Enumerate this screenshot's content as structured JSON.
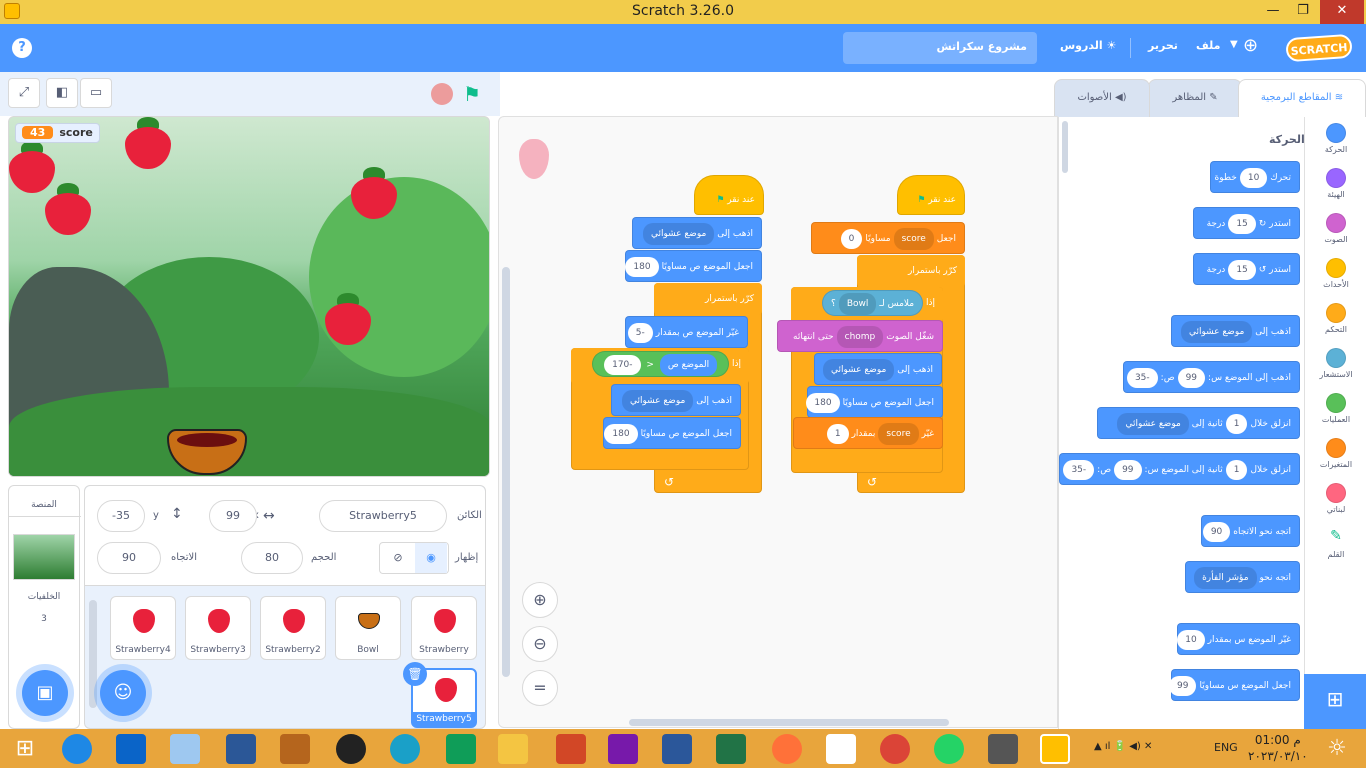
{
  "window": {
    "title": "Scratch 3.26.0",
    "minimize": "—",
    "restore": "❐",
    "close": "✕"
  },
  "menu": {
    "logo": "SCRATCH",
    "file": "ملف",
    "edit": "تحرير",
    "tutorials": "الدروس",
    "project_name": "مشروع سكراتش",
    "help": "?"
  },
  "tabs": {
    "code": "المقاطع البرمجية",
    "costumes": "المظاهر",
    "sounds": "الأصوات"
  },
  "stage": {
    "monitor_label": "score",
    "monitor_value": "43"
  },
  "sprite_info": {
    "sprite_label": "الكائن",
    "sprite_name": "Strawberry5",
    "x_label": "x",
    "x_value": "99",
    "y_label": "y",
    "y_value": "-35",
    "show_label": "إظهار",
    "size_label": "الحجم",
    "size_value": "80",
    "direction_label": "الاتجاه",
    "direction_value": "90"
  },
  "sprites": [
    "Strawberry",
    "Bowl",
    "Strawberry2",
    "Strawberry3",
    "Strawberry4",
    "Strawberry5"
  ],
  "stage_pane": {
    "title": "المنصة",
    "backdrops_label": "الخلفيات",
    "backdrops_count": "3"
  },
  "categories": [
    {
      "label": "الحركة",
      "color": "#4c97ff"
    },
    {
      "label": "الهيئة",
      "color": "#9966ff"
    },
    {
      "label": "الصوت",
      "color": "#cf63cf"
    },
    {
      "label": "الأحداث",
      "color": "#ffbf00"
    },
    {
      "label": "التحكم",
      "color": "#ffab19"
    },
    {
      "label": "الاستشعار",
      "color": "#5cb1d6"
    },
    {
      "label": "العمليات",
      "color": "#59c059"
    },
    {
      "label": "المتغيرات",
      "color": "#ff8c1a"
    },
    {
      "label": "لبناتي",
      "color": "#ff6680"
    },
    {
      "label": "القلم",
      "color": "#0fbd8c"
    }
  ],
  "palette": {
    "heading": "الحركة",
    "move": {
      "label": "تحرك",
      "value": "10",
      "suffix": "خطوة"
    },
    "turn_right": {
      "label": "استدر",
      "value": "15",
      "suffix": "درجة"
    },
    "turn_left": {
      "label": "استدر",
      "value": "15",
      "suffix": "درجة"
    },
    "goto": {
      "label": "اذهب إلى",
      "menu": "موضع عشوائي"
    },
    "goto_xy": {
      "label": "اذهب إلى الموضع س:",
      "x": "99",
      "y_label": "ص:",
      "y": "-35"
    },
    "glide": {
      "label": "انزلق خلال",
      "value": "1",
      "mid": "ثانية إلى",
      "menu": "موضع عشوائي"
    },
    "glide_xy": {
      "label": "انزلق خلال",
      "value": "1",
      "mid": "ثانية إلى الموضع س:",
      "x": "99",
      "y_label": "ص:",
      "y": "-35"
    },
    "point_dir": {
      "label": "اتجه نحو الاتجاه",
      "value": "90"
    },
    "point_towards": {
      "label": "اتجه نحو",
      "menu": "مؤشر الفأرة"
    },
    "change_x": {
      "label": "غيّر الموضع س بمقدار",
      "value": "10"
    },
    "set_x": {
      "label": "اجعل الموضع س مساويًا",
      "value": "99"
    }
  },
  "script1": {
    "hat": "عند نقر",
    "goto": "اذهب إلى",
    "goto_menu": "موضع عشوائي",
    "set_y": "اجعل الموضع ص مساويًا",
    "set_y_value": "180",
    "forever": "كرّر باستمرار",
    "change_y": "غيّر الموضع ص بمقدار",
    "change_y_value": "-5",
    "if": "إذا",
    "ypos": "الموضع ص",
    "lt": "<",
    "cmp_value": "-170",
    "goto2": "اذهب إلى",
    "goto2_menu": "موضع عشوائي",
    "set_y2": "اجعل الموضع ص مساويًا",
    "set_y2_value": "180"
  },
  "script2": {
    "hat": "عند نقر",
    "set": "اجعل",
    "var": "score",
    "equal": "مساويًا",
    "set_value": "0",
    "forever": "كرّر باستمرار",
    "if": "إذا",
    "touching": "ملامس لـ",
    "touching_menu": "Bowl",
    "q": "؟",
    "play": "شغّل الصوت",
    "sound": "chomp",
    "until_done": "حتى انتهائه",
    "goto": "اذهب إلى",
    "goto_menu": "موضع عشوائي",
    "set_y": "اجعل الموضع ص مساويًا",
    "set_y_value": "180",
    "change": "غيّر",
    "change_var": "score",
    "by": "بمقدار",
    "change_value": "1"
  },
  "taskbar": {
    "lang": "ENG",
    "time": "01:00 م",
    "date": "٢٠٢٣/٠٣/١٠"
  }
}
